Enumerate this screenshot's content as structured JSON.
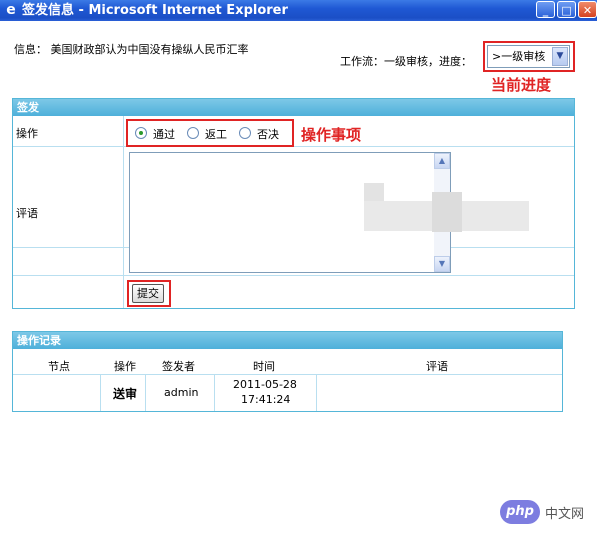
{
  "window": {
    "title": "签发信息 - Microsoft Internet Explorer",
    "minimize": "_",
    "maximize": "□",
    "close": "✕",
    "app_icon": "ie-page-icon"
  },
  "info": {
    "label": "信息：",
    "text": "美国财政部认为中国没有操纵人民币汇率"
  },
  "workflow": {
    "text": "工作流：一级审核，进度：",
    "progress_value": ">一级审核",
    "progress_options": [
      ">一级审核"
    ]
  },
  "annotations": {
    "progress": "当前进度",
    "operation": "操作事项",
    "color": "#e02424"
  },
  "sign_panel": {
    "header": "签发",
    "operation_label": "操作",
    "options": [
      {
        "label": "通过",
        "checked": true
      },
      {
        "label": "返工",
        "checked": false
      },
      {
        "label": "否决",
        "checked": false
      }
    ],
    "comment_label": "评语",
    "comment_value": "",
    "submit_label": "提交"
  },
  "log_panel": {
    "header": "操作记录",
    "columns": [
      "节点",
      "操作",
      "签发者",
      "时间",
      "评语"
    ],
    "rows": [
      {
        "node": "",
        "action": "送审",
        "signer": "admin",
        "date": "2011-05-28",
        "time": "17:41:24",
        "comment": ""
      }
    ]
  },
  "watermark": {
    "logo": "php",
    "text": "中文网"
  },
  "colors": {
    "titlebar": "#1f58d4",
    "panel_header": "#4eb0da",
    "panel_border": "#55b6d8"
  }
}
